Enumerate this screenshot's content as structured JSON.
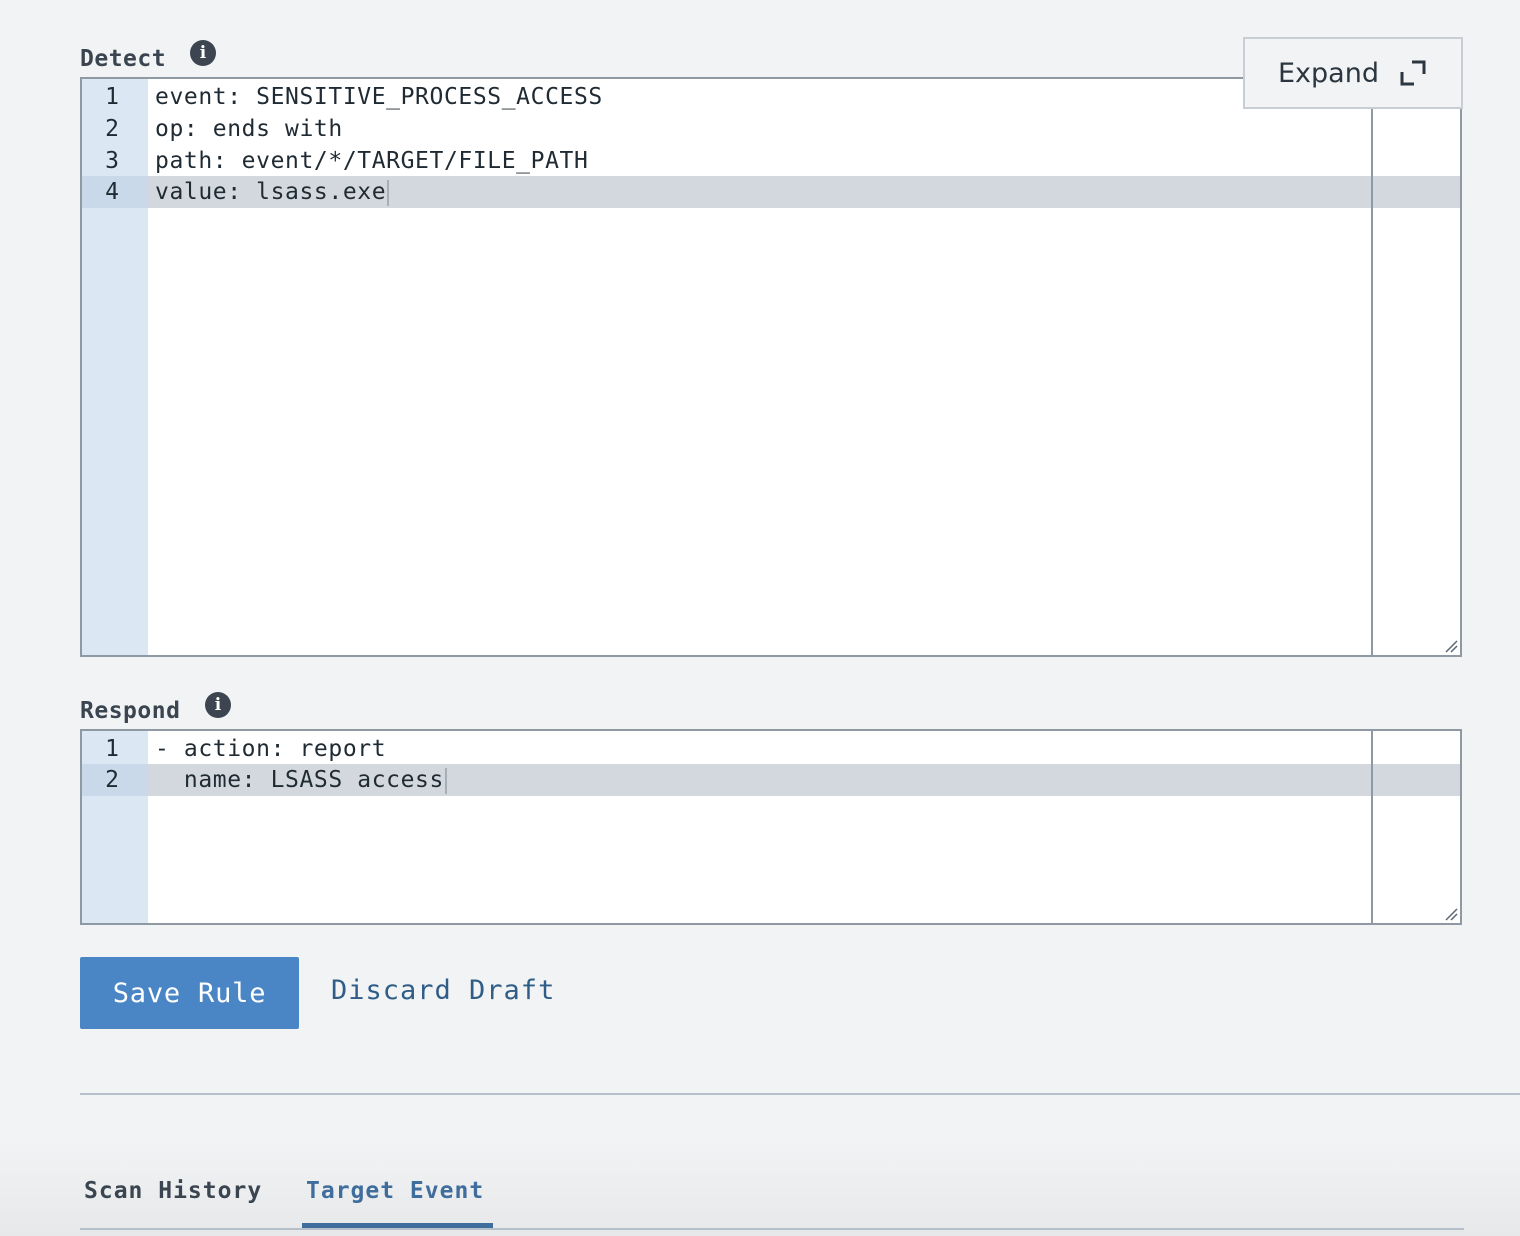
{
  "detect": {
    "label": "Detect",
    "lines": [
      {
        "number": "1",
        "text": "event: SENSITIVE_PROCESS_ACCESS"
      },
      {
        "number": "2",
        "text": "op: ends with"
      },
      {
        "number": "3",
        "text": "path: event/*/TARGET/FILE_PATH"
      },
      {
        "number": "4",
        "text": "value: lsass.exe"
      }
    ]
  },
  "respond": {
    "label": "Respond",
    "lines": [
      {
        "number": "1",
        "text": "- action: report"
      },
      {
        "number": "2",
        "text": "  name: LSASS access"
      }
    ]
  },
  "expand_button": {
    "label": "Expand",
    "icon": "expand-icon"
  },
  "actions": {
    "save_label": "Save Rule",
    "discard_label": "Discard Draft"
  },
  "tabs": [
    {
      "label": "Scan History",
      "active": false
    },
    {
      "label": "Target Event",
      "active": true
    }
  ],
  "colors": {
    "primary": "#4a86c5",
    "link": "#2f5d87",
    "active_tab": "#3f6d9c",
    "gutter": "#dbe7f3",
    "active_line": "#d3d8de"
  }
}
